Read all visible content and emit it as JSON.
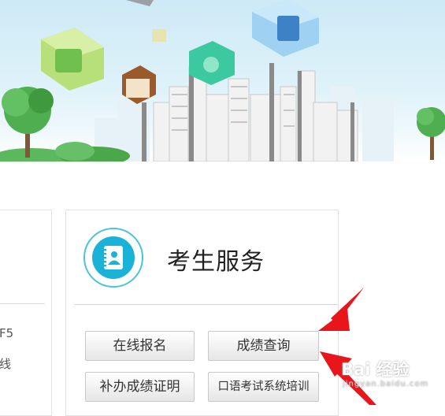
{
  "left_panel": {
    "text_line_1": "F5",
    "text_line_2": "线"
  },
  "service": {
    "title": "考生服务",
    "buttons": {
      "online_registration": "在线报名",
      "score_query": "成绩查询",
      "certificate_reissue": "补办成绩证明",
      "oral_exam_training": "口语考试系统培训"
    }
  },
  "watermark": {
    "main": "Bai 经验",
    "sub": "jingyan.baidu.com"
  },
  "colors": {
    "icon_accent": "#1ab2d6",
    "arrow": "#e8161b"
  },
  "icons": {
    "service": "contact-book-icon"
  }
}
